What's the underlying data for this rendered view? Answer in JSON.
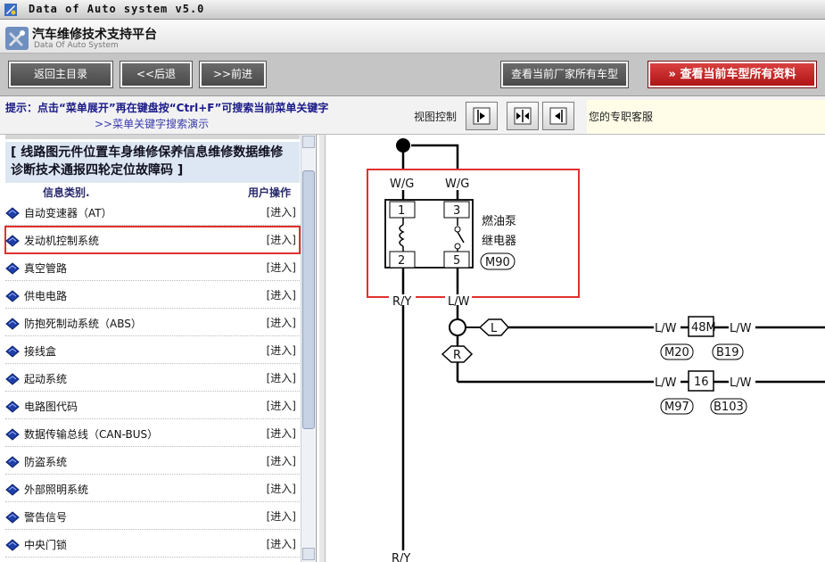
{
  "window": {
    "title": "Data of Auto system v5.0"
  },
  "brand": {
    "title_cn": "汽车维修技术支持平台",
    "title_en": "Data Of Auto System"
  },
  "toolbar": {
    "back_main": "返回主目录",
    "back": "<<后退",
    "forward": ">>前进",
    "view_all_models": "查看当前厂家所有车型",
    "view_all_data": "查看当前车型所有资料"
  },
  "hint": {
    "text": "提示：点击“菜单展开”再在键盘按“Ctrl+F”可搜索当前菜单关键字",
    "demo_link": ">>菜单关键字搜索演示",
    "view_control": "视图控制",
    "support": "您的专职客服"
  },
  "sidebar": {
    "breadcrumb": "[ 线路图元件位置车身维修保养信息维修数据维修诊断技术通报四轮定位故障码 ]",
    "col_category": "信息类别.",
    "col_action": "用户操作",
    "items": [
      {
        "label": "自动变速器（AT）",
        "action": "[进入]"
      },
      {
        "label": "发动机控制系统",
        "action": "[进入]"
      },
      {
        "label": "真空管路",
        "action": "[进入]"
      },
      {
        "label": "供电电路",
        "action": "[进入]"
      },
      {
        "label": "防抱死制动系统（ABS）",
        "action": "[进入]"
      },
      {
        "label": "接线盒",
        "action": "[进入]"
      },
      {
        "label": "起动系统",
        "action": "[进入]"
      },
      {
        "label": "电路图代码",
        "action": "[进入]"
      },
      {
        "label": "数据传输总线（CAN-BUS）",
        "action": "[进入]"
      },
      {
        "label": "防盗系统",
        "action": "[进入]"
      },
      {
        "label": "外部照明系统",
        "action": "[进入]"
      },
      {
        "label": "警告信号",
        "action": "[进入]"
      },
      {
        "label": "中央门锁",
        "action": "[进入]"
      }
    ],
    "selected_index": 1
  },
  "diagram": {
    "wire_wg_left": "W/G",
    "wire_wg_right": "W/G",
    "pin1": "1",
    "pin2": "2",
    "pin3": "3",
    "pin5": "5",
    "relay_name_1": "燃油泵",
    "relay_name_2": "继电器",
    "relay_code": "M90",
    "wire_ry": "R/Y",
    "wire_lw_top": "L/W",
    "conn_l": "L",
    "conn_r": "R",
    "lw1": "L/W",
    "box1": "48M",
    "lw2": "L/W",
    "c_m20": "M20",
    "c_b19": "B19",
    "lw3": "L/W",
    "box2": "16",
    "lw4": "L/W",
    "c_m97": "M97",
    "c_b103": "B103",
    "wire_bottom": "R/Y"
  },
  "colors": {
    "highlight": "#e03030",
    "toolbar_red": "#c41f1f"
  }
}
